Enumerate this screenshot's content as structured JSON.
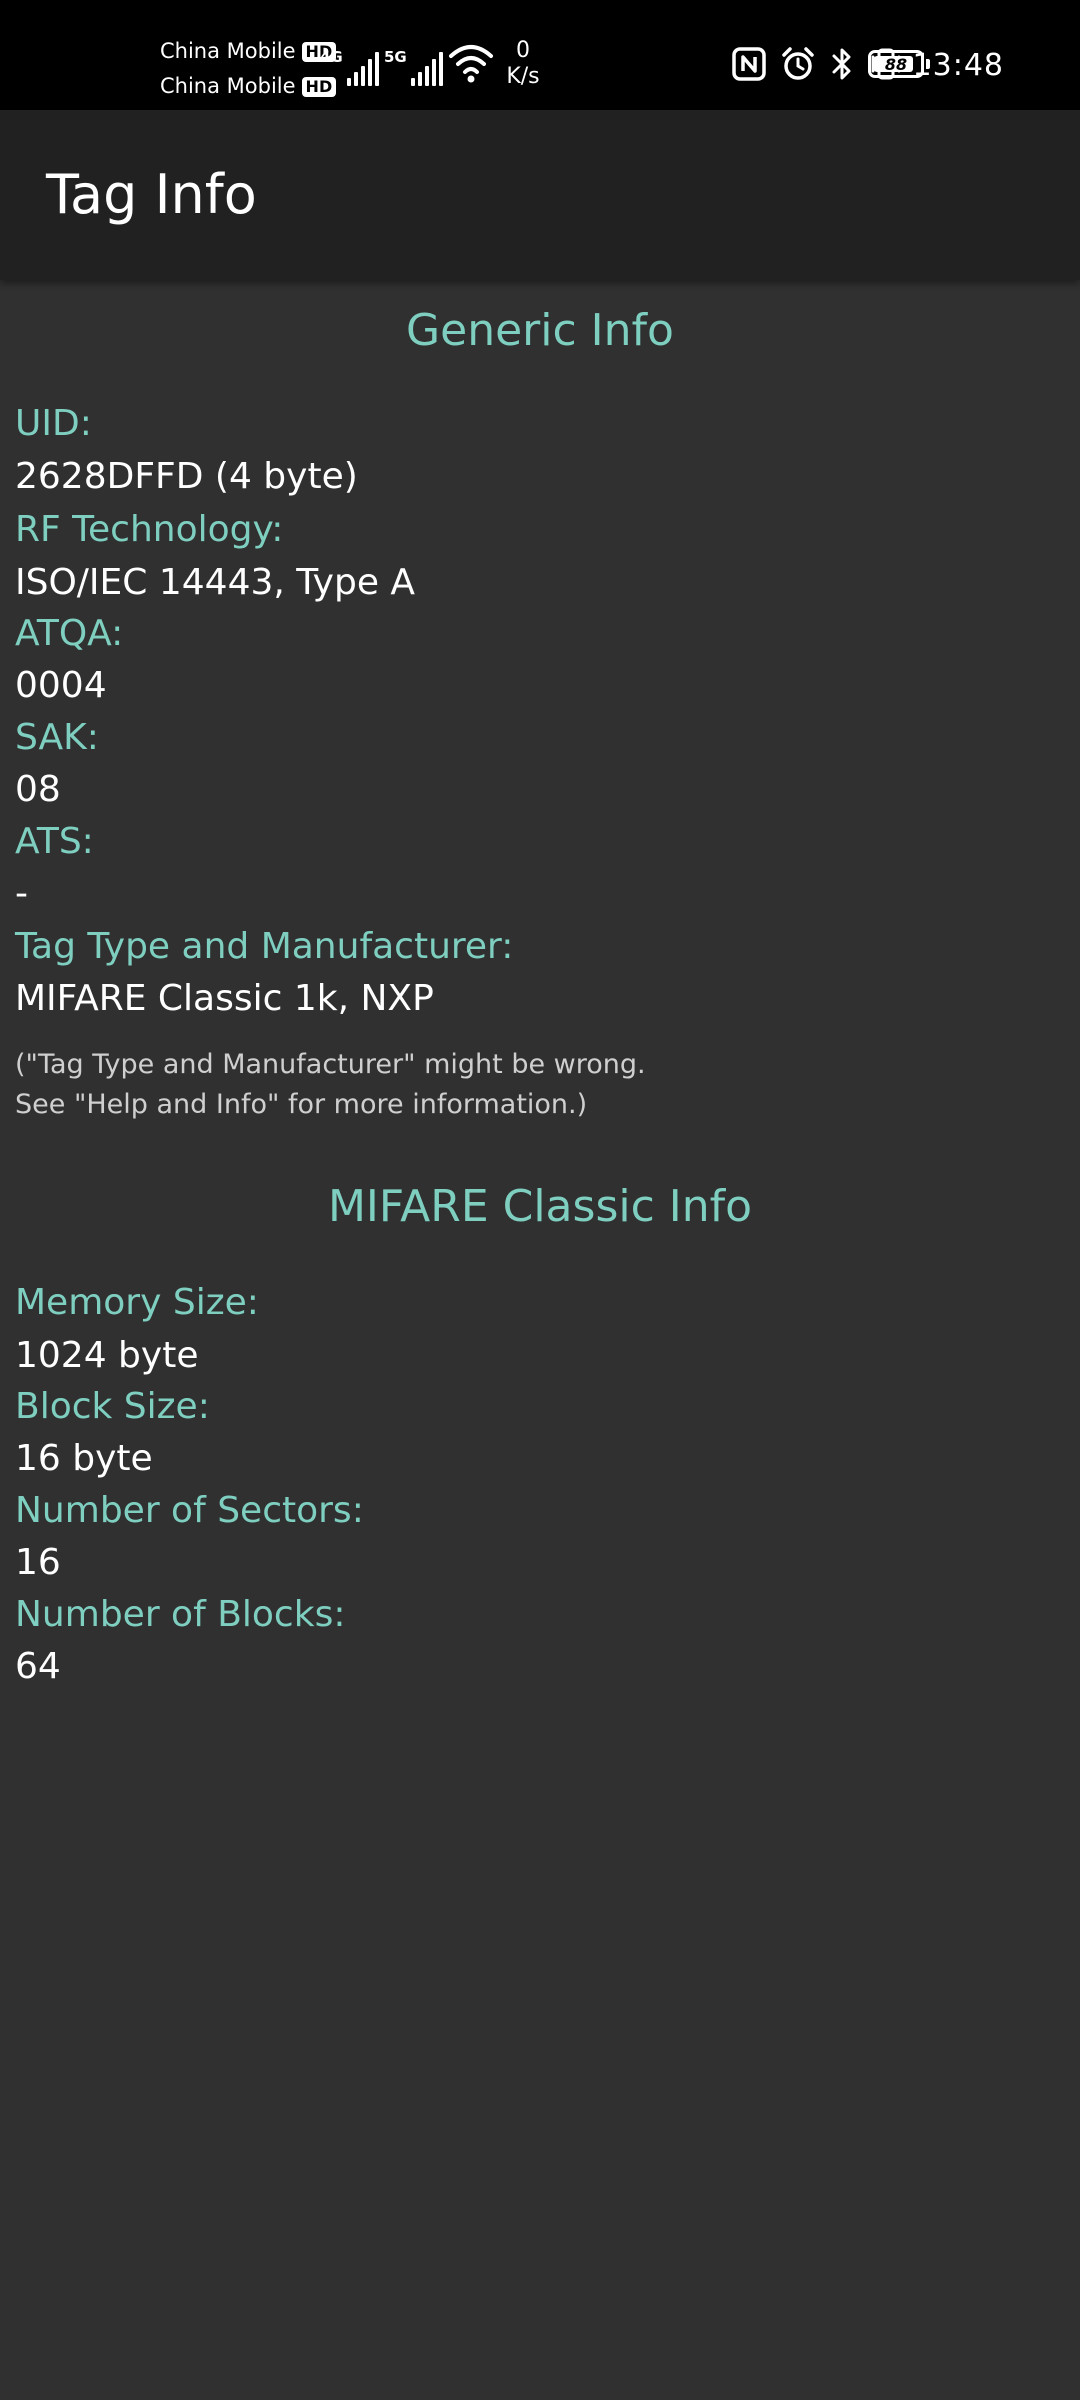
{
  "status_bar": {
    "carrier_1": "China Mobile",
    "carrier_2": "China Mobile",
    "hd_badge": "HD",
    "network_1": "4G",
    "network_2": "5G",
    "net_speed_value": "0",
    "net_speed_unit": "K/s",
    "battery_level": "88",
    "time": "13:48",
    "icons": [
      "nfc-icon",
      "alarm-icon",
      "bluetooth-icon",
      "vibrate-icon",
      "battery-icon",
      "wifi-icon",
      "signal-icon"
    ]
  },
  "app_bar": {
    "title": "Tag Info"
  },
  "generic_info": {
    "title": "Generic Info",
    "uid_label": "UID:",
    "uid_value": "2628DFFD (4 byte)",
    "rf_label": "RF Technology:",
    "rf_value": "ISO/IEC 14443, Type A",
    "atqa_label": "ATQA:",
    "atqa_value": "0004",
    "sak_label": "SAK:",
    "sak_value": "08",
    "ats_label": "ATS:",
    "ats_value": "-",
    "tag_type_label": "Tag Type and Manufacturer:",
    "tag_type_value": "MIFARE Classic 1k, NXP",
    "note_line_1": "(\"Tag Type and Manufacturer\" might be wrong.",
    "note_line_2": "See \"Help and Info\" for more information.)"
  },
  "mifare_info": {
    "title": "MIFARE Classic Info",
    "memory_label": "Memory Size:",
    "memory_value": "1024 byte",
    "block_size_label": "Block Size:",
    "block_size_value": "16 byte",
    "sectors_label": "Number of Sectors:",
    "sectors_value": "16",
    "blocks_label": "Number of Blocks:",
    "blocks_value": "64"
  },
  "colors": {
    "accent": "#7ecfc0",
    "background": "#303030",
    "app_bar": "#212121",
    "status_bar": "#000000"
  }
}
